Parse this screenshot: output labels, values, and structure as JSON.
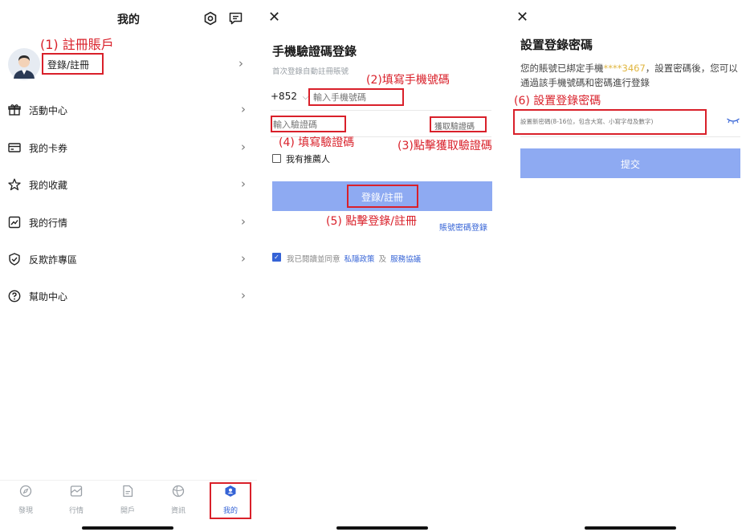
{
  "panel1": {
    "header_title": "我的",
    "annotation_register": "(1) 註冊賬戶",
    "login_label": "登錄/註冊",
    "menu_items": [
      {
        "label": "活動中心",
        "icon": "gift-icon"
      },
      {
        "label": "我的卡券",
        "icon": "card-icon"
      },
      {
        "label": "我的收藏",
        "icon": "star-icon"
      },
      {
        "label": "我的行情",
        "icon": "chart-icon"
      },
      {
        "label": "反欺詐專區",
        "icon": "shield-check-icon"
      },
      {
        "label": "幫助中心",
        "icon": "help-icon"
      }
    ],
    "tabs": [
      {
        "label": "發現",
        "icon": "compass-icon"
      },
      {
        "label": "行情",
        "icon": "market-icon"
      },
      {
        "label": "開戶",
        "icon": "account-open-icon"
      },
      {
        "label": "資訊",
        "icon": "globe-icon"
      },
      {
        "label": "我的",
        "icon": "profile-icon",
        "active": true
      }
    ],
    "accent_color": "#3563d6"
  },
  "panel2": {
    "title": "手機驗證碼登錄",
    "subtitle": "首次登錄自動註冊賬號",
    "country_code": "+852",
    "phone_placeholder": "輸入手機號碼",
    "code_placeholder": "輸入驗證碼",
    "get_code_label": "獲取驗證碼",
    "referrer_label": "我有推薦人",
    "login_button": "登錄/註冊",
    "password_login_link": "賬號密碼登錄",
    "agree_prefix": "我已閱讀並同意",
    "privacy_link": "私隱政策",
    "and_text": "及",
    "service_link": "服務協議",
    "anno_phone": "(2)填寫手機號碼",
    "anno_code": "(4) 填寫驗證碼",
    "anno_get_code": "(3)點擊獲取驗證碼",
    "anno_login": "(5) 點擊登錄/註冊",
    "button_color": "#8eaaf2",
    "link_color": "#3563d6"
  },
  "panel3": {
    "title": "設置登錄密碼",
    "desc_prefix": "您的賬號已綁定手機",
    "phone_masked": "****3467",
    "desc_suffix": "，設置密碼後，您可以通過該手機號碼和密碼進行登錄",
    "password_placeholder": "設置新密碼(8-16位，包含大寫、小寫字母及數字)",
    "submit_label": "提交",
    "anno_password": "(6) 設置登錄密碼",
    "highlight_color": "#e0b640",
    "button_color": "#8eaaf2"
  }
}
